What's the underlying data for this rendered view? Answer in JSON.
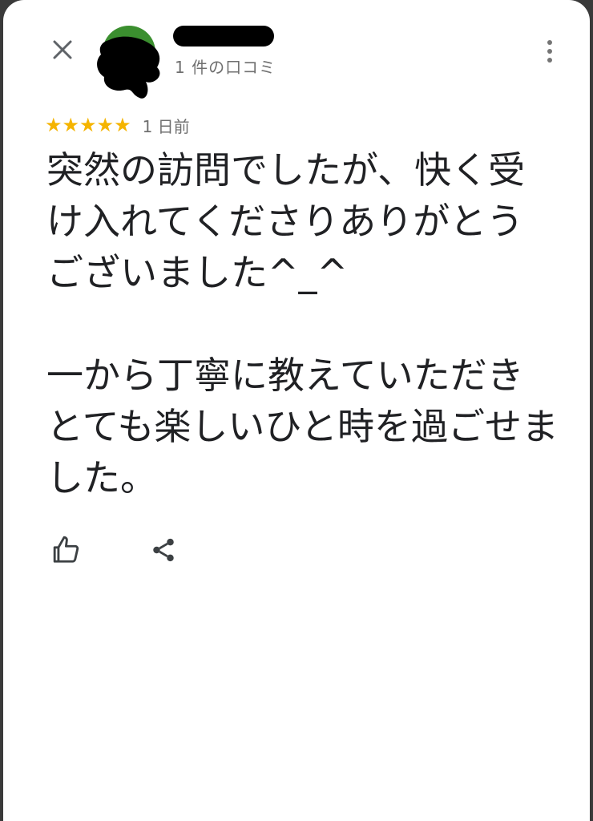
{
  "reviewer": {
    "review_count": "1 件の口コミ",
    "avatar_color": "#3b8f2f"
  },
  "icons": {
    "close": "close-icon",
    "more": "more-vert-icon",
    "like": "thumb-up-icon",
    "share": "share-icon",
    "star": "star-icon"
  },
  "review": {
    "rating": 5,
    "stars": "★★★★★",
    "star_color": "#f5b400",
    "date": "1 日前",
    "text": "突然の訪問でしたが、快く受け入れてくださりありがとうございました^_^\n\n一から丁寧に教えていただきとても楽しいひと時を過ごせました。"
  }
}
